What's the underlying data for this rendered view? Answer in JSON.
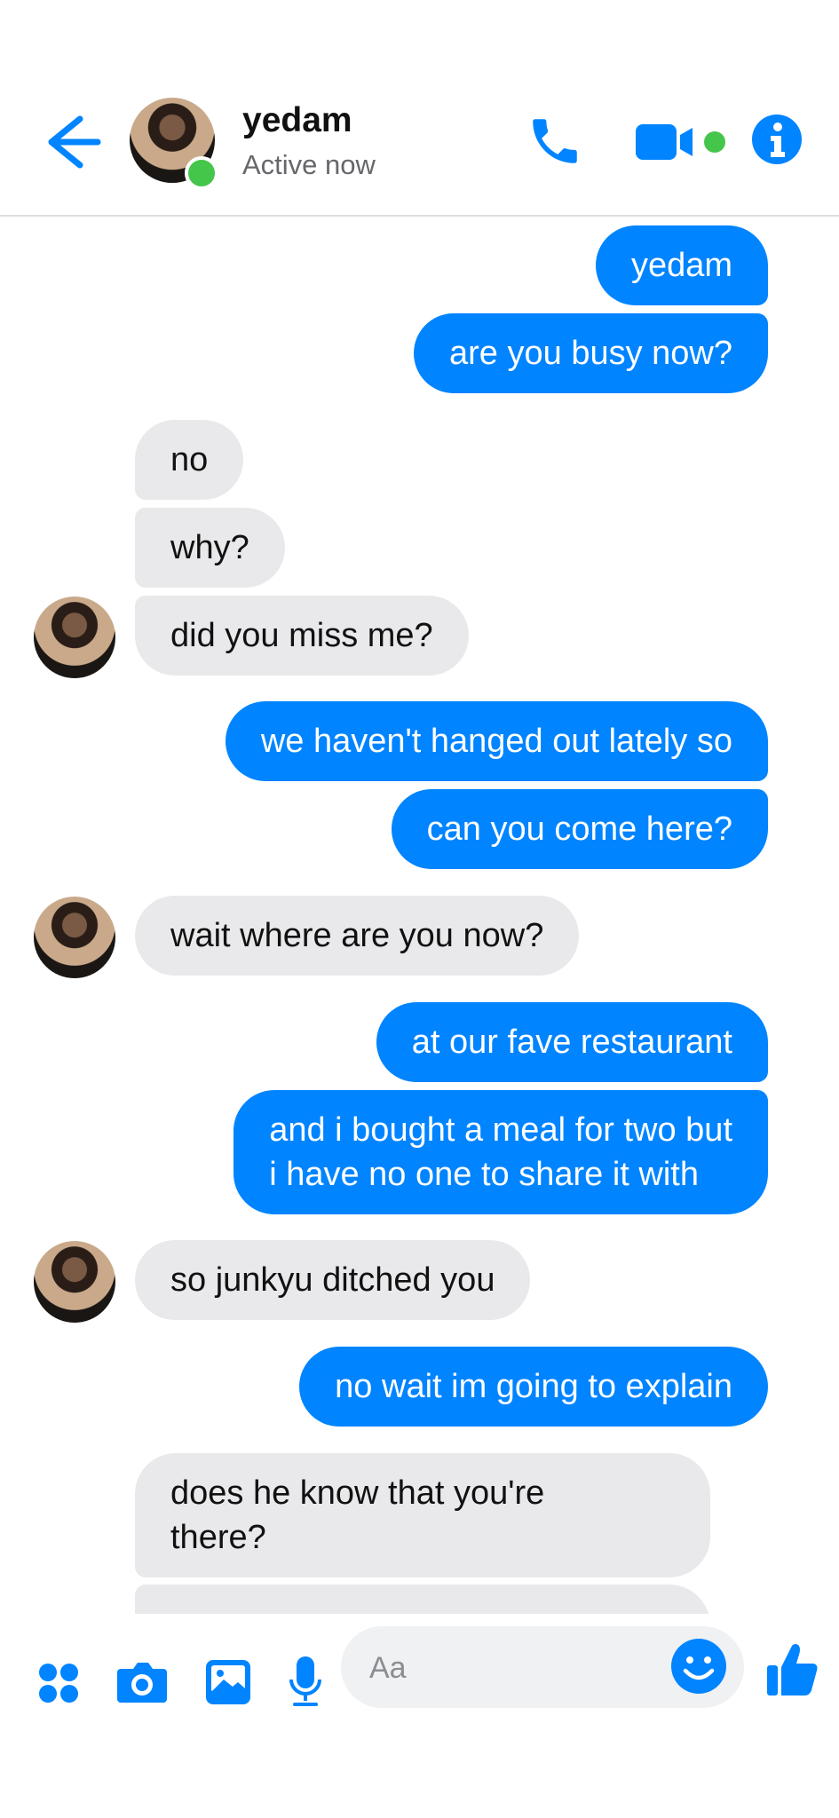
{
  "colors": {
    "accent": "#0084ff",
    "online": "#44c64a",
    "incoming_bubble": "#e9e9eb"
  },
  "header": {
    "back_icon": "arrow-left-icon",
    "contact_name": "yedam",
    "status": "Active now",
    "call_icon": "phone-icon",
    "video_icon": "video-camera-icon",
    "info_icon": "info-icon"
  },
  "messages": [
    {
      "from": "me",
      "text": "yedam"
    },
    {
      "from": "me",
      "text": "are you busy now?"
    },
    {
      "from": "them",
      "text": "no"
    },
    {
      "from": "them",
      "text": "why?"
    },
    {
      "from": "them",
      "text": "did you miss me?"
    },
    {
      "from": "me",
      "text": "we haven't hanged out lately so"
    },
    {
      "from": "me",
      "text": "can you come here?"
    },
    {
      "from": "them",
      "text": "wait where are you now?"
    },
    {
      "from": "me",
      "text": "at our fave restaurant"
    },
    {
      "from": "me",
      "lines": [
        "and i bought a meal for two but",
        "i have no one to share it with"
      ]
    },
    {
      "from": "them",
      "text": "so junkyu ditched you"
    },
    {
      "from": "me",
      "text": "no wait im going to explain"
    },
    {
      "from": "them",
      "lines": [
        "does he know that you're",
        "there?"
      ]
    }
  ],
  "composer": {
    "apps_icon": "apps-icon",
    "camera_icon": "camera-icon",
    "gallery_icon": "image-icon",
    "mic_icon": "microphone-icon",
    "placeholder": "Aa",
    "emoji_icon": "smiley-icon",
    "like_icon": "thumbs-up-icon"
  }
}
